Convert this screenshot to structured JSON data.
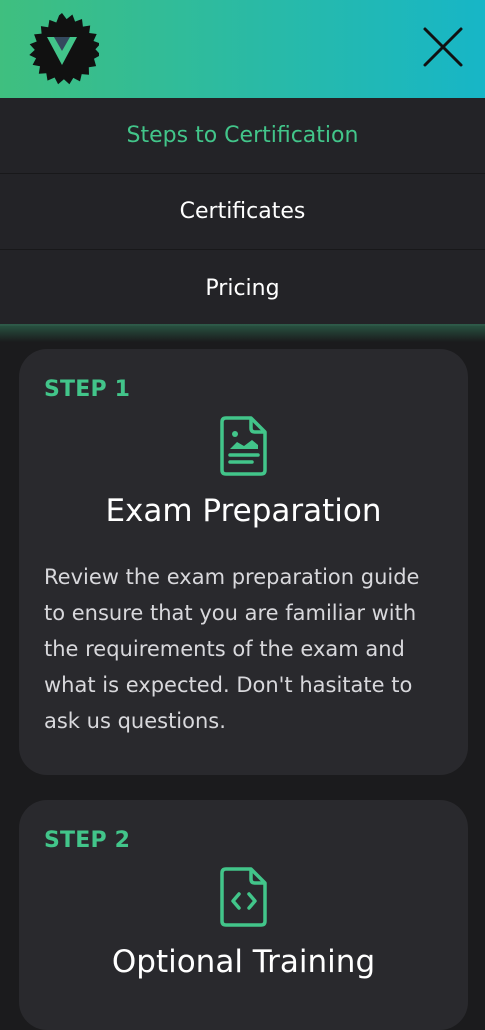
{
  "header": {
    "logo_icon": "vue-logo-badge-icon",
    "close_icon": "close-icon"
  },
  "menu": {
    "items": [
      {
        "label": "Steps to Certification",
        "active": true
      },
      {
        "label": "Certificates",
        "active": false
      },
      {
        "label": "Pricing",
        "active": false
      }
    ]
  },
  "steps": [
    {
      "step_label": "STEP 1",
      "icon": "document-icon",
      "title": "Exam Preparation",
      "description": "Review the exam preparation guide to ensure that you are familiar with the requirements of the exam and what is expected. Don't hasitate to ask us questions."
    },
    {
      "step_label": "STEP 2",
      "icon": "code-file-icon",
      "title": "Optional Training"
    }
  ],
  "colors": {
    "accent": "#42c58a",
    "header_gradient_start": "#3fbf7f",
    "header_gradient_end": "#17b6c7",
    "background": "#1b1b1d",
    "menu_bg": "#232327",
    "card_bg": "#29292d"
  }
}
